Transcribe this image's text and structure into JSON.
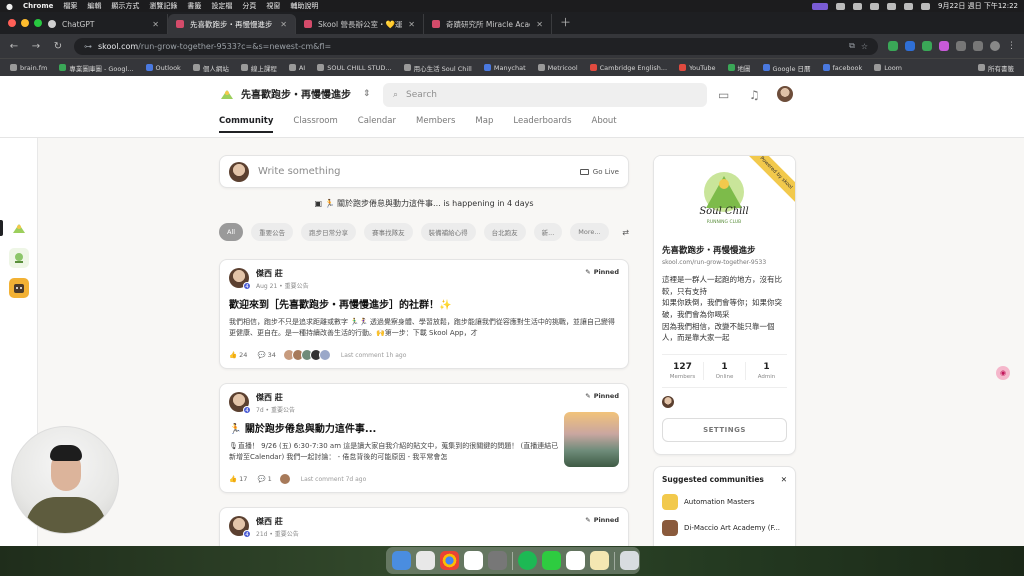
{
  "menubar": {
    "app": "Chrome",
    "items": [
      "檔案",
      "編輯",
      "顯示方式",
      "瀏覽記錄",
      "書籤",
      "設定檔",
      "分頁",
      "視窗",
      "輔助說明"
    ],
    "datetime": "9月22日 週日 下午12:22"
  },
  "browser": {
    "tabs": [
      {
        "label": "ChatGPT",
        "active": false
      },
      {
        "label": "先喜歡跑步・再慢慢進步",
        "active": true
      },
      {
        "label": "Skool 營長辦公室・💛運用互動",
        "active": false
      },
      {
        "label": "奇蹟研究所 Miracle Academy",
        "active": false
      }
    ],
    "url_host": "skool.com",
    "url_path": "/run-grow-together-9533?c=&s=newest-cm&fl=",
    "bookmarks": [
      "brain.fm",
      "專業圖庫圖 - Googl...",
      "Outlook",
      "個人網站",
      "線上課程",
      "AI",
      "SOUL CHILL STUD...",
      "用心生活 Soul Chill",
      "Manychat",
      "Metricool",
      "Cambridge English...",
      "YouTube",
      "地圖",
      "Google 日曆",
      "facebook",
      "Loom",
      "所有書籤"
    ]
  },
  "header": {
    "community_name": "先喜歡跑步・再慢慢進步",
    "search_placeholder": "Search",
    "nav": [
      "Community",
      "Classroom",
      "Calendar",
      "Members",
      "Map",
      "Leaderboards",
      "About"
    ]
  },
  "composer": {
    "placeholder": "Write something",
    "golive": "Go Live"
  },
  "event": {
    "text": "🏃 關於跑步倦怠與動力這件事... is happening in 4 days"
  },
  "filters": [
    "All",
    "重要公告",
    "跑步日常分享",
    "賽事找隊友",
    "裝備補給心得",
    "台北跑友",
    "新...",
    "More..."
  ],
  "posts": [
    {
      "author": "傑西 莊",
      "level": "4",
      "meta": "Aug 21 • 重要公告",
      "pinned": "Pinned",
      "title": "歡迎來到［先喜歡跑步・再慢慢進步］的社群！✨",
      "body": "我們相信，跑步不只是追求距離或數字 🏃‍♂️🏃‍♀️ 透過覺察身體、學習放鬆，跑步能讓我們從容應對生活中的挑戰，並讓自己變得更健康、更自在。是一種持續改善生活的行動。🙌第一步：下載 Skool App，才",
      "likes": "24",
      "comments": "34",
      "last": "Last comment 1h ago"
    },
    {
      "author": "傑西 莊",
      "level": "4",
      "meta": "7d • 重要公告",
      "pinned": "Pinned",
      "title": "🏃 關於跑步倦怠與動力這件事...",
      "body": "🎙直播！ 9/26 (五) 6:30-7:30 am 這是讀大家自我介紹的貼文中，蒐集到的很關鍵的問題！ (直播連結已新增至Calendar) 我們一起討論： - 倦怠背後的可能原因 - 我平常會怎",
      "likes": "17",
      "comments": "1",
      "last": "Last comment 7d ago"
    },
    {
      "author": "傑西 莊",
      "level": "4",
      "meta": "21d • 重要公告",
      "pinned": "Pinned",
      "title": "",
      "body": "",
      "likes": "",
      "comments": "",
      "last": ""
    }
  ],
  "about": {
    "ribbon": "Powered by skool",
    "logo_text": "Soul Chill",
    "logo_sub": "RUNNING CLUB",
    "name": "先喜歡跑步・再慢慢進步",
    "url": "skool.com/run-grow-together-9533",
    "description": "這裡是一群人一起跑的地方，沒有比較，只有支持\n如果你跌倒，我們會等你；如果你突破，我們會為你喝采\n因為我們相信，改變不能只靠一個人，而是靠大家一起",
    "stats": [
      {
        "value": "127",
        "label": "Members"
      },
      {
        "value": "1",
        "label": "Online"
      },
      {
        "value": "1",
        "label": "Admin"
      }
    ],
    "settings": "SETTINGS"
  },
  "suggested": {
    "title": "Suggested communities",
    "items": [
      "Automation Masters",
      "Di-Maccio Art Academy (F..."
    ]
  },
  "colors": {
    "accent": "#202124",
    "ribbon": "#f2c94c",
    "skool_brand": "#d44b6a",
    "level_badge": "#4a5bd4"
  }
}
